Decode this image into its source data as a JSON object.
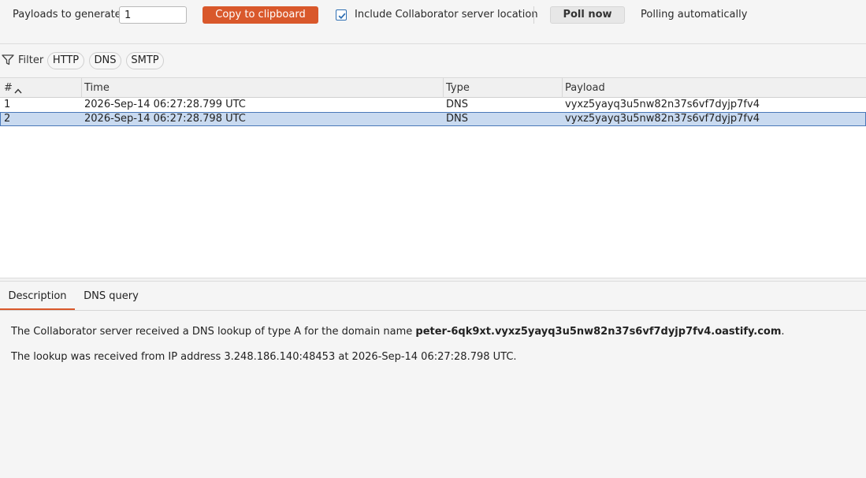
{
  "toolbar": {
    "payloads_label": "Payloads to generate:",
    "payloads_value": "1",
    "copy_label": "Copy to clipboard",
    "include_label": "Include Collaborator server location",
    "include_checked": true,
    "poll_label": "Poll now",
    "poll_status": "Polling automatically"
  },
  "filter": {
    "label": "Filter",
    "chips": [
      "HTTP",
      "DNS",
      "SMTP"
    ]
  },
  "table": {
    "columns": [
      "#",
      "Time",
      "Type",
      "Payload"
    ],
    "rows": [
      {
        "num": "1",
        "time": "2026-Sep-14 06:27:28.799 UTC",
        "type": "DNS",
        "payload": "vyxz5yayq3u5nw82n37s6vf7dyjp7fv4"
      },
      {
        "num": "2",
        "time": "2026-Sep-14 06:27:28.798 UTC",
        "type": "DNS",
        "payload": "vyxz5yayq3u5nw82n37s6vf7dyjp7fv4"
      }
    ],
    "selected_row": 2
  },
  "details": {
    "tabs": [
      "Description",
      "DNS query"
    ],
    "active_tab": "Description",
    "line1_prefix": "The Collaborator server received a DNS lookup of type A for the domain name ",
    "line1_domain": "peter-6qk9xt.vyxz5yayq3u5nw82n37s6vf7dyjp7fv4.oastify.com",
    "line1_suffix": ".",
    "line2": "The lookup was received from IP address 3.248.186.140:48453 at 2026-Sep-14 06:27:28.798 UTC."
  },
  "colors": {
    "accent": "#d9582b",
    "selection": "#c9daf0",
    "selection_border": "#4a78b8"
  }
}
